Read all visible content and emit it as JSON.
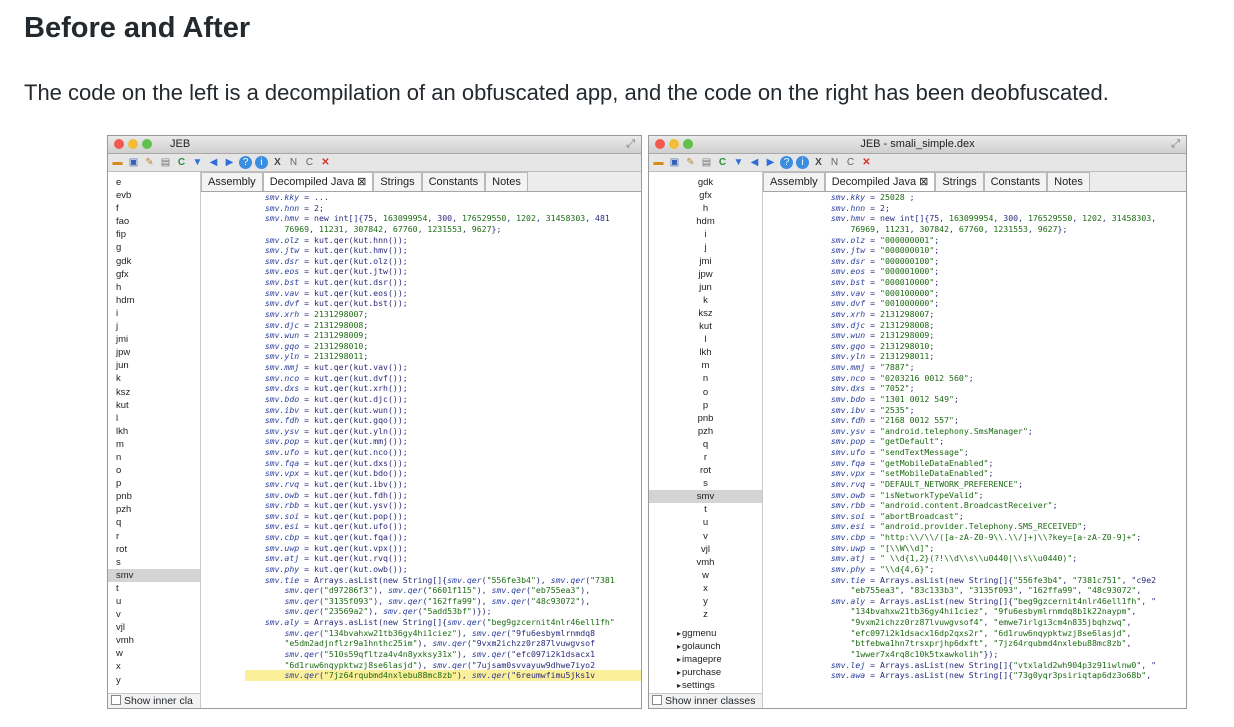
{
  "heading": "Before and After",
  "intro": "The code on the left is a decompilation of an obfuscated app, and the code on the right has been deobfuscated.",
  "colors": {
    "red": "#f25a50",
    "yellow": "#f2be3a",
    "green": "#5fc14a",
    "selection": "#d4d4d4",
    "highlight": "#fbef9a"
  },
  "toolbar_icons": [
    "folder-icon",
    "save-icon",
    "wrench-icon",
    "copy-icon",
    "refresh-icon",
    "filter-icon",
    "back-icon",
    "forward-icon",
    "help-icon",
    "info-icon",
    "x-icon",
    "n-icon",
    "c-icon",
    "cancel-icon"
  ],
  "left": {
    "title": "JEB",
    "tabs": [
      "Assembly",
      "Decompiled Java ⊠",
      "Strings",
      "Constants",
      "Notes"
    ],
    "sidebar": [
      "e",
      "evb",
      "f",
      "fao",
      "fip",
      "g",
      "gdk",
      "gfx",
      "h",
      "hdm",
      "i",
      "j",
      "jmi",
      "jpw",
      "jun",
      "k",
      "ksz",
      "kut",
      "l",
      "lkh",
      "m",
      "n",
      "o",
      "p",
      "pnb",
      "pzh",
      "q",
      "r",
      "rot",
      "s",
      "smv",
      "t",
      "u",
      "v",
      "vjl",
      "vmh",
      "w",
      "x",
      "y"
    ],
    "selected": "smv",
    "show_inner": "Show inner cla",
    "code": [
      "    smv.kky = ...",
      "    smv.hnn = 2;",
      "    smv.hmv = new int[]{75, 163099954, 300, 176529550, 1202, 31458303, 481​",
      "        76969, 11231, 307842, 67760, 1231553, 9627};",
      "    smv.olz = kut.qer(kut.hnn());",
      "    smv.jtw = kut.qer(kut.hmv());",
      "    smv.dsr = kut.qer(kut.olz());",
      "    smv.eos = kut.qer(kut.jtw());",
      "    smv.bst = kut.qer(kut.dsr());",
      "    smv.vav = kut.qer(kut.eos());",
      "    smv.dvf = kut.qer(kut.bst());",
      "    smv.xrh = 2131298007;",
      "    smv.djc = 2131298008;",
      "    smv.wun = 2131298009;",
      "    smv.gqo = 2131298010;",
      "    smv.yln = 2131298011;",
      "    smv.mmj = kut.qer(kut.vav());",
      "    smv.nco = kut.qer(kut.dvf());",
      "    smv.dxs = kut.qer(kut.xrh());",
      "    smv.bdo = kut.qer(kut.djc());",
      "    smv.ibv = kut.qer(kut.wun());",
      "    smv.fdh = kut.qer(kut.gqo());",
      "    smv.ysv = kut.qer(kut.yln());",
      "    smv.pop = kut.qer(kut.mmj());",
      "    smv.ufo = kut.qer(kut.nco());",
      "    smv.fqa = kut.qer(kut.dxs());",
      "    smv.vpx = kut.qer(kut.bdo());",
      "    smv.rvq = kut.qer(kut.ibv());",
      "    smv.owb = kut.qer(kut.fdh());",
      "    smv.rbb = kut.qer(kut.ysv());",
      "    smv.soi = kut.qer(kut.pop());",
      "    smv.esi = kut.qer(kut.ufo());",
      "    smv.cbp = kut.qer(kut.fqa());",
      "    smv.uwp = kut.qer(kut.vpx());",
      "    smv.atj = kut.qer(kut.rvq());",
      "    smv.phy = kut.qer(kut.owb());",
      "    smv.tie = Arrays.asList(new String[]{smv.qer(\"556fe3b4\"), smv.qer(\"7381",
      "        smv.qer(\"d97286f3\"), smv.qer(\"6601f115\"), smv.qer(\"eb755ea3\"),",
      "        smv.qer(\"3135f093\"), smv.qer(\"162ffa99\"), smv.qer(\"48c93072\"),",
      "        smv.qer(\"23569a2\"), smv.qer(\"5add53bf\")});",
      "    smv.aly = Arrays.asList(new String[]{smv.qer(\"beg9gzcernit4nlr46ell1fh\"",
      "        smv.qer(\"134bvahxw21tb36gy4hi1ciez\"), smv.qer(\"9fu6esbymlrnmdq8",
      "        \"e5dm2adjnflzr9a1hnthc25im\"), smv.qer(\"9vxm2ichzz0rz87lvuwgvsof",
      "        smv.qer(\"510s59qfltza4v4n8yxksy31x\"), smv.qer(\"efc097i2k1dsacx1",
      "        \"6d1ruw6nqypktwzj8se6lasjd\"), smv.qer(\"7ujsam0svvayuw9dhwe7iyo2",
      "        smv.qer(\"7jz64rqubmd4nxlebu88mc8zb\"), smv.qer(\"6reumwfimu5jks1v"
    ]
  },
  "right": {
    "title": "JEB - smali_simple.dex",
    "tabs": [
      "Assembly",
      "Decompiled Java ⊠",
      "Strings",
      "Constants",
      "Notes"
    ],
    "sidebar": [
      "gdk",
      "gfx",
      "h",
      "hdm",
      "i",
      "j",
      "jmi",
      "jpw",
      "jun",
      "k",
      "ksz",
      "kut",
      "l",
      "lkh",
      "m",
      "n",
      "o",
      "p",
      "pnb",
      "pzh",
      "q",
      "r",
      "rot",
      "s",
      "smv",
      "t",
      "u",
      "v",
      "vjl",
      "vmh",
      "w",
      "x",
      "y",
      "z"
    ],
    "selected": "smv",
    "tree": [
      "ggmenu",
      "golaunch",
      "imagepre",
      "purchase",
      "settings"
    ],
    "show_inner": "Show inner classes",
    "code": [
      "    smv.kky = 25028 ;",
      "    smv.hnn = 2;",
      "    smv.hmv = new int[]{75, 163099954, 300, 176529550, 1202, 31458303,",
      "        76969, 11231, 307842, 67760, 1231553, 9627};",
      "    smv.olz = \"000000001\";",
      "    smv.jtw = \"000000010\";",
      "    smv.dsr = \"000000100\";",
      "    smv.eos = \"000001000\";",
      "    smv.bst = \"000010000\";",
      "    smv.vav = \"000100000\";",
      "    smv.dvf = \"001000000\";",
      "    smv.xrh = 2131298007;",
      "    smv.djc = 2131298008;",
      "    smv.wun = 2131298009;",
      "    smv.gqo = 2131298010;",
      "    smv.yln = 2131298011;",
      "    smv.mmj = \"7887\";",
      "    smv.nco = \"0203216 0012 560\";",
      "    smv.dxs = \"7052\";",
      "    smv.bdo = \"1301 0012 549\";",
      "    smv.ibv = \"2535\";",
      "    smv.fdh = \"2168 0012 557\";",
      "    smv.ysv = \"android.telephony.SmsManager\";",
      "    smv.pop = \"getDefault\";",
      "    smv.ufo = \"sendTextMessage\";",
      "    smv.fqa = \"getMobileDataEnabled\";",
      "    smv.vpx = \"setMobileDataEnabled\";",
      "    smv.rvq = \"DEFAULT_NETWORK_PREFERENCE\";",
      "    smv.owb = \"isNetworkTypeValid\";",
      "    smv.rbb = \"android.content.BroadcastReceiver\";",
      "    smv.soi = \"abortBroadcast\";",
      "    smv.esi = \"android.provider.Telephony.SMS_RECEIVED\";",
      "    smv.cbp = \"http:\\\\/\\\\/([a-zA-Z0-9\\\\.\\\\/]+)\\\\?key=[a-zA-Z0-9]+\";",
      "    smv.uwp = \"[\\\\W\\\\d]\";",
      "    smv.atj = \" \\\\d{1,2}(?!\\\\d\\\\s\\\\u0440|\\\\s\\\\u0440)\";",
      "    smv.phy = \"\\\\d{4,6}\";",
      "    smv.tie = Arrays.asList(new String[]{\"556fe3b4\", \"7381c751\", \"c9e2",
      "        \"eb755ea3\", \"83c133b3\", \"3135f093\", \"162ffa99\", \"48c93072\",",
      "    smv.aly = Arrays.asList(new String[]{\"beg9gzcernit4nlr46ell1fh\", \"",
      "        \"134bvahxw21tb36gy4hi1ciez\", \"9fu6esbymlrnmdq8b1k22naypm\",",
      "        \"9vxm2ichzz0rz87lvuwgvsof4\", \"emwe7irlgi3cm4n835jbqhzwq\",",
      "        \"efc097i2k1dsacx16dp2qxs2r\", \"6d1ruw6nqypktwzj8se6lasjd\",",
      "        \"btfebwa1hn7trsxprjhp6dxft\", \"7jz64rqubmd4nxlebu88mc8zb\",",
      "        \"1wwer7x4rq8c10k5txawkolih\"});",
      "    smv.lej = Arrays.asList(new String[]{\"vtxlald2wh904p3z91iwlnw0\", \"",
      "    smv.awa = Arrays.asList(new String[]{\"73g0yqr3psiriqtap6dz3o68b\","
    ]
  }
}
